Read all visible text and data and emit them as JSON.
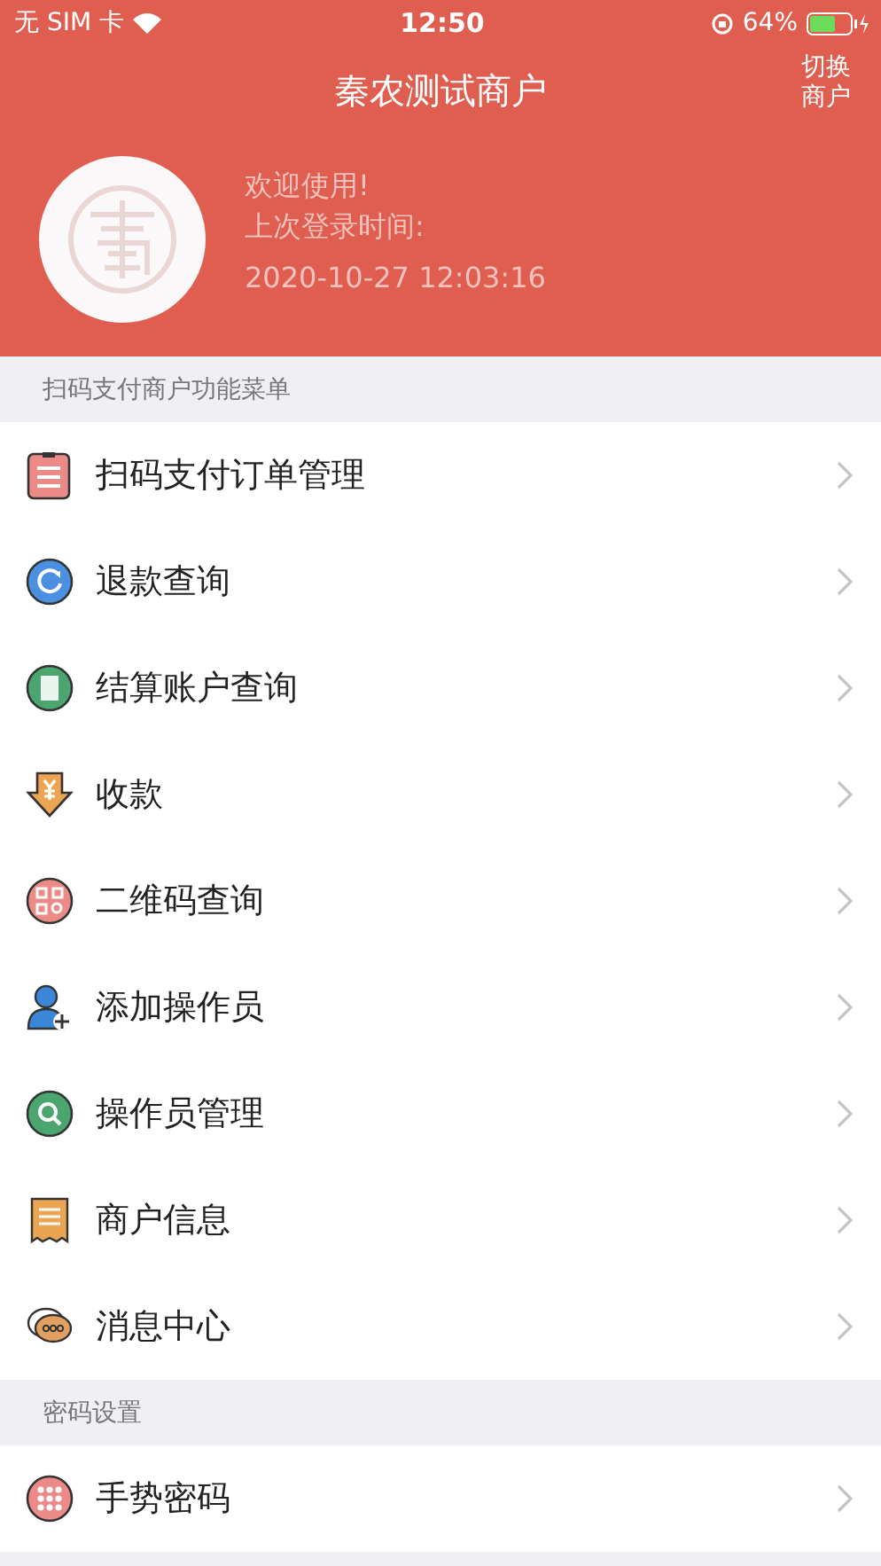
{
  "status_bar": {
    "carrier": "无 SIM 卡",
    "time": "12:50",
    "battery": "64%"
  },
  "header": {
    "title": "秦农测试商户",
    "switch_button": "切换商户",
    "welcome": "欢迎使用!",
    "last_login_label": "上次登录时间:",
    "last_login_time": "2020-10-27 12:03:16"
  },
  "sections": [
    {
      "title": "扫码支付商户功能菜单",
      "items": [
        {
          "kind": "order",
          "label": "扫码支付订单管理"
        },
        {
          "kind": "refund",
          "label": "退款查询"
        },
        {
          "kind": "account",
          "label": "结算账户查询"
        },
        {
          "kind": "receive",
          "label": "收款"
        },
        {
          "kind": "qrcode",
          "label": "二维码查询"
        },
        {
          "kind": "add-user",
          "label": "添加操作员"
        },
        {
          "kind": "search",
          "label": "操作员管理"
        },
        {
          "kind": "receipt",
          "label": "商户信息"
        },
        {
          "kind": "message",
          "label": "消息中心"
        }
      ]
    },
    {
      "title": "密码设置",
      "items": [
        {
          "kind": "gesture",
          "label": "手势密码"
        }
      ]
    }
  ]
}
